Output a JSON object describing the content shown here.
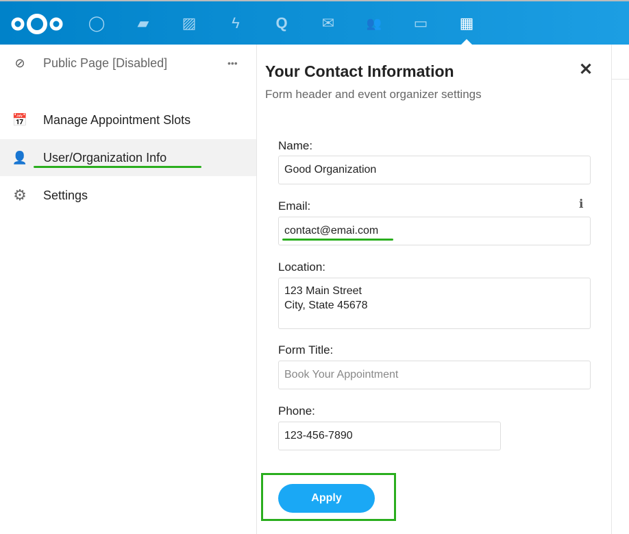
{
  "header": {
    "apps": [
      {
        "name": "logo-icon"
      },
      {
        "name": "dashboard-icon",
        "glyph": "◯"
      },
      {
        "name": "files-icon",
        "glyph": "▰"
      },
      {
        "name": "photos-icon",
        "glyph": "▨"
      },
      {
        "name": "activity-icon",
        "glyph": "ϟ"
      },
      {
        "name": "talk-icon",
        "glyph": "Q"
      },
      {
        "name": "mail-icon",
        "glyph": "✉"
      },
      {
        "name": "contacts-icon",
        "glyph": "👥"
      },
      {
        "name": "calendar-icon",
        "glyph": "▭"
      },
      {
        "name": "appointments-icon",
        "glyph": "▦"
      }
    ]
  },
  "sidebar": {
    "public_page": "Public Page [Disabled]",
    "more": "•••",
    "items": [
      {
        "label": "Manage Appointment Slots"
      },
      {
        "label": "User/Organization Info"
      },
      {
        "label": "Settings"
      }
    ]
  },
  "panel": {
    "title": "Your Contact Information",
    "subtitle": "Form header and event organizer settings",
    "close": "✕",
    "name_label": "Name:",
    "name_value": "Good Organization",
    "email_label": "Email:",
    "email_value": "contact@emai.com",
    "info": "i",
    "location_label": "Location:",
    "location_value": "123 Main Street\nCity, State 45678",
    "form_title_label": "Form Title:",
    "form_title_placeholder": "Book Your Appointment",
    "phone_label": "Phone:",
    "phone_value": "123-456-7890",
    "apply": "Apply"
  },
  "colors": {
    "header": "#0082c9",
    "accent": "#1aa8f5",
    "highlight": "#2aae1e"
  }
}
